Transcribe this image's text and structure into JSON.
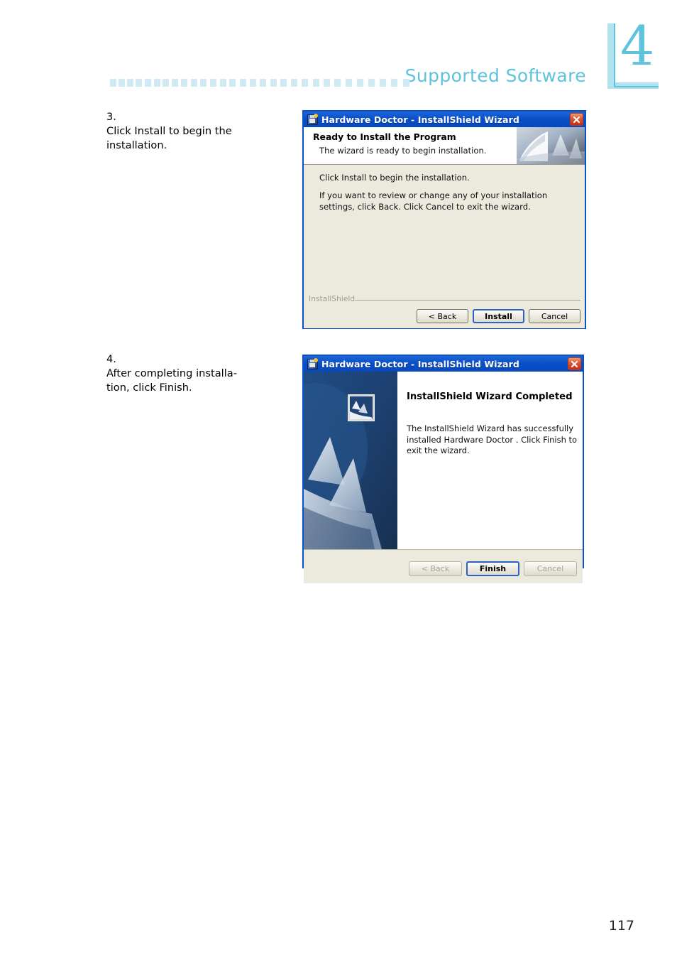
{
  "page": {
    "chapter_number": "4",
    "header_title": "Supported Software",
    "page_number": "117"
  },
  "instructions": [
    {
      "number": "3.",
      "line1": "Click Install to begin the",
      "line2": "installation."
    },
    {
      "number": "4.",
      "line1": "After completing installa-",
      "line2": "tion, click Finish."
    }
  ],
  "dialog_ready": {
    "titlebar": {
      "title": "Hardware Doctor - InstallShield Wizard",
      "icon": "installer-disk-icon",
      "close_label": "Close"
    },
    "banner": {
      "heading": "Ready to Install the Program",
      "subheading": "The wizard is ready to begin installation."
    },
    "body": {
      "line1": "Click Install to begin the installation.",
      "line2": "If you want to review or change any of your installation settings, click Back. Click Cancel to exit the wizard."
    },
    "footer": {
      "brand": "InstallShield",
      "buttons": [
        {
          "label": "< Back",
          "state": "enabled"
        },
        {
          "label": "Install",
          "state": "default"
        },
        {
          "label": "Cancel",
          "state": "enabled"
        }
      ]
    }
  },
  "dialog_completed": {
    "titlebar": {
      "title": "Hardware Doctor - InstallShield Wizard",
      "icon": "installer-disk-icon",
      "close_label": "Close"
    },
    "content": {
      "heading": "InstallShield Wizard Completed",
      "paragraph": "The InstallShield Wizard has successfully installed Hardware Doctor . Click Finish to exit the wizard."
    },
    "footer": {
      "buttons": [
        {
          "label": "< Back",
          "state": "disabled"
        },
        {
          "label": "Finish",
          "state": "default"
        },
        {
          "label": "Cancel",
          "state": "disabled"
        }
      ]
    }
  },
  "colors": {
    "accent": "#5fc3dd",
    "accent_light": "#cfeaf4",
    "titlebar_blue": "#0a50c8",
    "dialog_beige": "#ece9dd",
    "close_red": "#c82a10",
    "art_blue": "#1b3a68"
  }
}
